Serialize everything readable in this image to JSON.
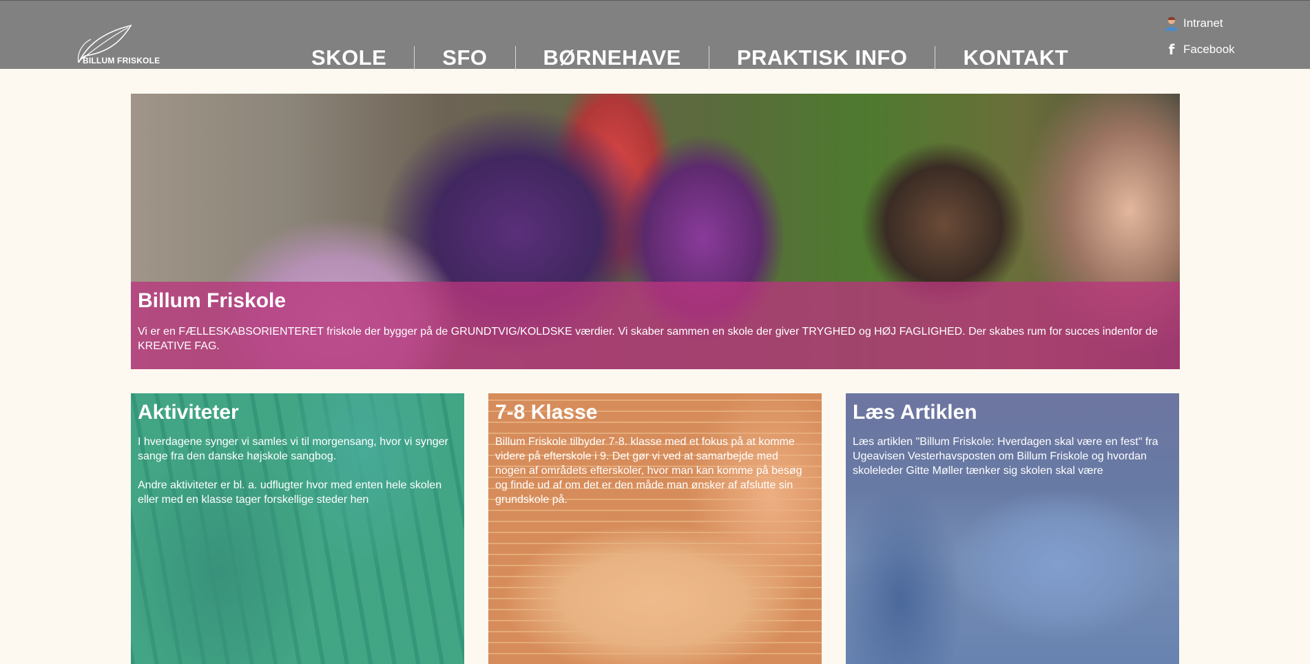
{
  "brand": {
    "name": "BILLUM FRISKOLE",
    "logo_icon": "leaf-icon"
  },
  "nav": {
    "items": [
      {
        "label": "SKOLE"
      },
      {
        "label": "SFO"
      },
      {
        "label": "BØRNEHAVE"
      },
      {
        "label": "PRAKTISK INFO"
      },
      {
        "label": "KONTAKT"
      }
    ]
  },
  "top_links": {
    "intranet": {
      "label": "Intranet",
      "icon": "person-icon"
    },
    "facebook": {
      "label": "Facebook",
      "icon": "facebook-icon"
    }
  },
  "hero": {
    "title": "Billum Friskole",
    "text": "Vi er en FÆLLESKABSORIENTERET friskole der bygger på de GRUNDTVIG/KOLDSKE værdier. Vi skaber sammen en skole der giver TRYGHED og HØJ FAGLIGHED. Der skabes rum for succes indenfor de KREATIVE FAG.",
    "band_color": "#b8367e"
  },
  "cards": [
    {
      "title": "Aktiviteter",
      "paragraphs": [
        "I hverdagene synger vi samles vi til morgensang, hvor vi synger sange fra den danske højskole sangbog.",
        "Andre aktiviteter er bl. a. udflugter hvor med enten hele skolen eller med en klasse tager forskellige steder hen"
      ],
      "color": "#38b494"
    },
    {
      "title": "7-8 Klasse",
      "paragraphs": [
        "Billum Friskole tilbyder 7-8. klasse med et fokus på at komme videre på efterskole i 9. Det gør vi ved at samarbejde med nogen af områdets efterskoler, hvor man kan komme på besøg og finde ud af om det er den måde man ønsker af afslutte sin grundskole på."
      ],
      "color": "#eea668"
    },
    {
      "title": "Læs Artiklen",
      "paragraphs": [
        "Læs artiklen \"Billum Friskole: Hverdagen skal være en fest\" fra Ugeavisen Vesterhavsposten om Billum Friskole og hvordan skoleleder Gitte Møller tænker sig skolen skal være"
      ],
      "color": "#5880c4"
    }
  ],
  "colors": {
    "header_bg": "#818181",
    "page_bg": "#fdf9f1"
  }
}
